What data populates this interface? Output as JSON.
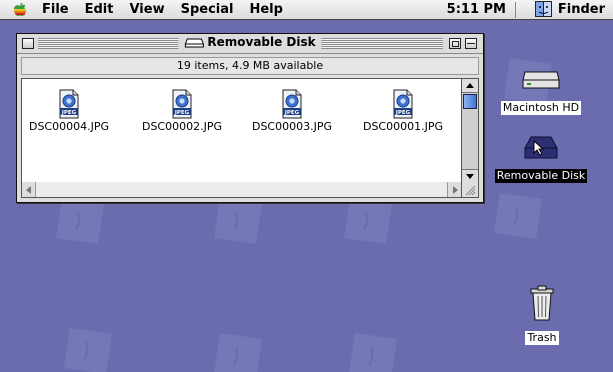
{
  "menubar": {
    "items": [
      "File",
      "Edit",
      "View",
      "Special",
      "Help"
    ],
    "clock": "5:11 PM",
    "active_app": "Finder"
  },
  "window": {
    "title": "Removable Disk",
    "info": "19 items, 4.9 MB available",
    "files": [
      {
        "name": "DSC00004.JPG",
        "badge": "JPEG"
      },
      {
        "name": "DSC00002.JPG",
        "badge": "JPEG"
      },
      {
        "name": "DSC00003.JPG",
        "badge": "JPEG"
      },
      {
        "name": "DSC00001.JPG",
        "badge": "JPEG"
      }
    ]
  },
  "desktop": {
    "icons": [
      {
        "label": "Macintosh HD"
      },
      {
        "label": "Removable Disk"
      },
      {
        "label": "Trash"
      }
    ]
  },
  "colors": {
    "desktop": "#6a6cae",
    "selection": "#000000",
    "scroll_thumb": "#3e74d4"
  }
}
